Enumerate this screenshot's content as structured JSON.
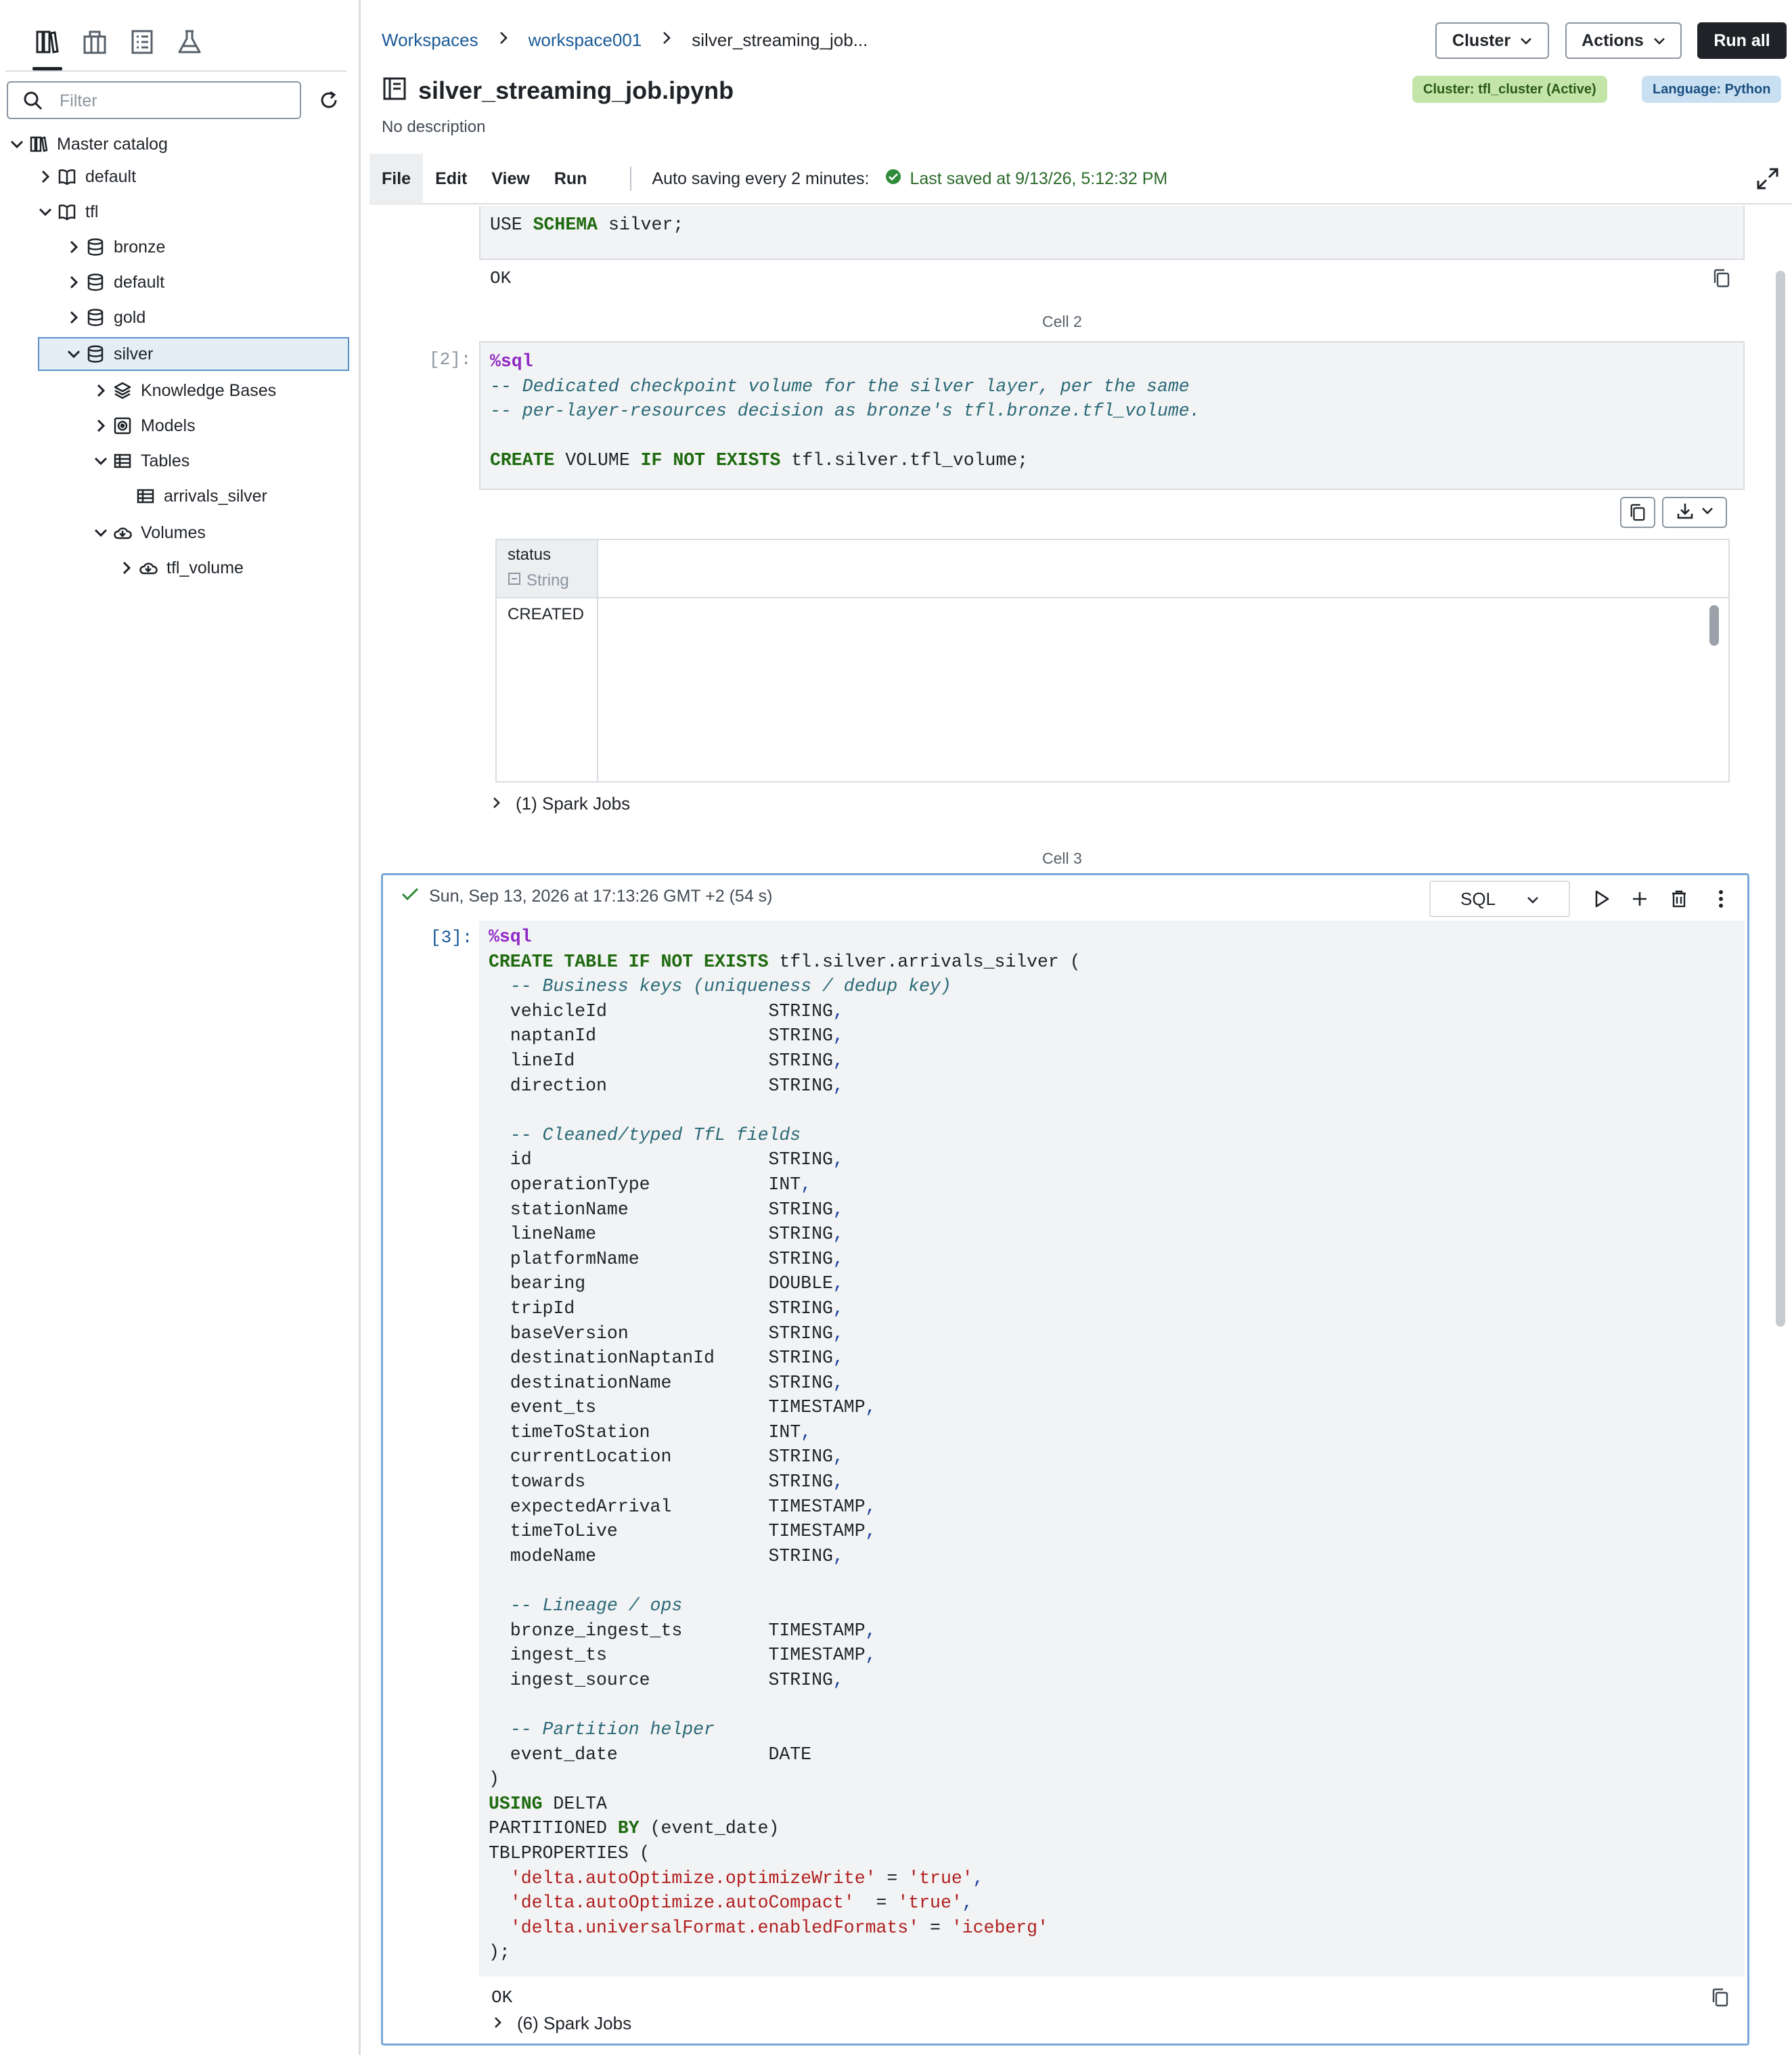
{
  "sidebar": {
    "filter_placeholder": "Filter",
    "tree": [
      {
        "label": "Master catalog",
        "icon": "catalog-icon"
      },
      {
        "label": "default",
        "icon": "book-icon"
      },
      {
        "label": "tfl",
        "icon": "book-icon"
      },
      {
        "label": "bronze",
        "icon": "schema-icon"
      },
      {
        "label": "default",
        "icon": "schema-icon"
      },
      {
        "label": "gold",
        "icon": "schema-icon"
      },
      {
        "label": "silver",
        "icon": "schema-icon"
      },
      {
        "label": "Knowledge Bases",
        "icon": "layers-icon"
      },
      {
        "label": "Models",
        "icon": "model-icon"
      },
      {
        "label": "Tables",
        "icon": "table-icon"
      },
      {
        "label": "arrivals_silver",
        "icon": "table-icon"
      },
      {
        "label": "Volumes",
        "icon": "volume-icon"
      },
      {
        "label": "tfl_volume",
        "icon": "volume-icon"
      }
    ]
  },
  "header": {
    "breadcrumb": [
      "Workspaces",
      "workspace001",
      "silver_streaming_job..."
    ],
    "buttons": {
      "cluster": "Cluster",
      "actions": "Actions",
      "run_all": "Run all"
    },
    "title": "silver_streaming_job.ipynb",
    "description": "No description",
    "badge_cluster": "Cluster: tfl_cluster (Active)",
    "badge_language": "Language: Python"
  },
  "menubar": {
    "items": [
      "File",
      "Edit",
      "View",
      "Run"
    ],
    "autosave": "Auto saving every 2 minutes:",
    "last_saved": "Last saved at 9/13/26, 5:12:32 PM"
  },
  "cell1": {
    "output": "OK"
  },
  "cell2": {
    "label": "Cell 2",
    "prompt": "[2]:",
    "result": {
      "column": "status",
      "type": "String",
      "rows": [
        "CREATED"
      ]
    },
    "jobs": "(1) Spark Jobs"
  },
  "cell3": {
    "label": "Cell 3",
    "prompt": "[3]:",
    "status": "Sun, Sep 13, 2026 at 17:13:26 GMT +2 (54 s)",
    "language": "SQL",
    "output": "OK",
    "jobs": "(6) Spark Jobs"
  },
  "colors": {
    "keyword": "#1e6a0f",
    "comment": "#2a6a78",
    "string": "#b01f1f",
    "magic": "#8f28c4",
    "accent": "#1a5a96"
  }
}
